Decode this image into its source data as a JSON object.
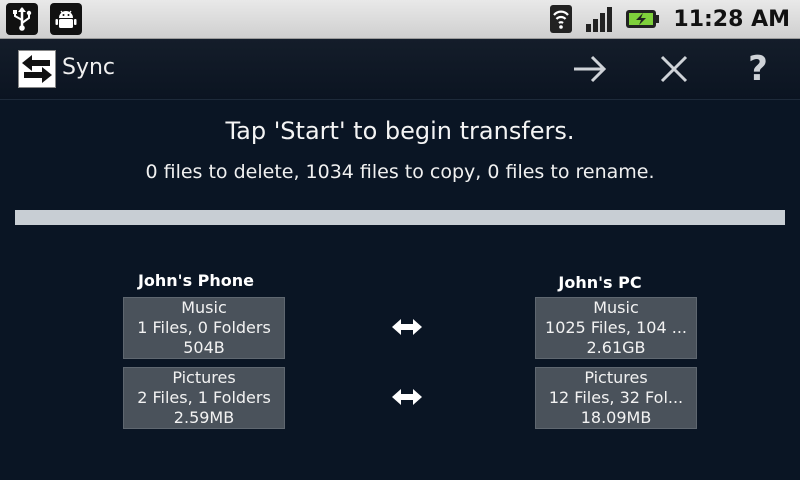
{
  "status_bar": {
    "time": "11:28 AM",
    "icons": [
      "usb-icon",
      "android-debug-icon",
      "wifi-icon",
      "signal-icon",
      "battery-charging-icon"
    ]
  },
  "title_bar": {
    "title": "Sync",
    "actions": [
      "start-arrow-icon",
      "cancel-x-icon",
      "help-question-icon"
    ],
    "help_glyph": "?"
  },
  "message": "Tap 'Start' to begin transfers.",
  "summary": "0 files to delete, 1034 files to copy, 0 files to rename.",
  "progress": 0,
  "devices": {
    "left": "John's Phone",
    "right": "John's PC"
  },
  "rows": [
    {
      "left": {
        "name": "Music",
        "counts": "1 Files, 0 Folders",
        "size": "504B"
      },
      "right": {
        "name": "Music",
        "counts": "1025 Files, 104 ...",
        "size": "2.61GB"
      }
    },
    {
      "left": {
        "name": "Pictures",
        "counts": "2 Files, 1 Folders",
        "size": "2.59MB"
      },
      "right": {
        "name": "Pictures",
        "counts": "12 Files, 32 Fol...",
        "size": "18.09MB"
      }
    }
  ]
}
